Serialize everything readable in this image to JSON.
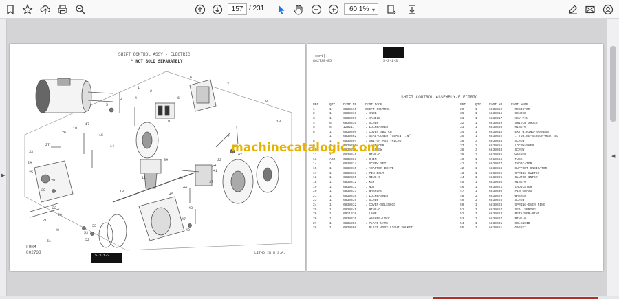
{
  "toolbar": {
    "page_current": "157",
    "page_total": "/ 231",
    "zoom": "60.1%",
    "icons": {
      "left": [
        "bookmark-icon",
        "star-icon",
        "upload-icon",
        "print-icon",
        "zoom-search-icon"
      ],
      "center": [
        "prev-page-icon",
        "next-page-icon",
        "select-cursor-icon",
        "hand-icon",
        "zoom-out-icon",
        "zoom-in-icon",
        "fit-page-icon",
        "download-icon"
      ],
      "right": [
        "annotate-icon",
        "mail-icon",
        "account-icon"
      ]
    },
    "colors": {
      "cursor_active": "#1a73e8"
    }
  },
  "left_page": {
    "header": "SHIFT CONTROL ASSY - ELECTRIC",
    "note": "* NOT SOLD SEPARATELY",
    "form_label": "FORM",
    "form_number": "802738",
    "page_ref": "5-3-1-3",
    "litho": "LITHO IN U.S.A."
  },
  "right_page": {
    "header_left_1": "(cont)",
    "header_left_2": "802738-85",
    "page_ref": "5-3-1-3",
    "table_title": "SHIFT CONTROL ASSEMBLY-ELECTRIC",
    "columns": [
      "REF",
      "QTY",
      "PART NO",
      "PART NAME",
      "REF",
      "QTY",
      "PART NO",
      "PART NAME"
    ],
    "rows_left": [
      [
        "1",
        "1",
        "6836515",
        "SHIFT CONTROL"
      ],
      [
        "2",
        "1",
        "6839310",
        ". KNOB"
      ],
      [
        "3",
        "1",
        "6839309",
        ". HANDLE"
      ],
      [
        "4",
        "6",
        "6839336",
        ". SCREW"
      ],
      [
        "5",
        "6",
        "120217",
        ". LOCKWASHER"
      ],
      [
        "6",
        "1",
        "6839306",
        ". COVER SWITCH"
      ],
      [
        "7",
        "1",
        "6839362",
        ". SEAL-COVER \"CEMENT IN\""
      ],
      [
        "8",
        "1",
        "6839304",
        ". SWITCH ASSY-MICRO"
      ],
      [
        "9",
        "1",
        "6839307",
        ". . SPACER"
      ],
      [
        "10",
        "4",
        "6839308",
        ". . SCREW"
      ],
      [
        "11",
        "1",
        "6839346",
        ". RING-O"
      ],
      [
        "13",
        "ASR",
        "6839363",
        ". SHIM"
      ],
      [
        "14",
        "1",
        "6839314",
        ". SCREW SET"
      ],
      [
        "15",
        "1",
        "6839315",
        ". ADAPTER DRIVE"
      ],
      [
        "17",
        "1",
        "6839311",
        ". PIN BOLT"
      ],
      [
        "18",
        "1",
        "6839365",
        ". RING-O"
      ],
      [
        "18",
        "1",
        "6839312",
        ". KEY"
      ],
      [
        "19",
        "1",
        "6839313",
        ". NUT"
      ],
      [
        "20",
        "1",
        "6839337",
        ". WASHING"
      ],
      [
        "21",
        "1",
        "6839338",
        ". LOCKWASHER"
      ],
      [
        "23",
        "1",
        "6839339",
        ". SCREW"
      ],
      [
        "24",
        "1",
        "6839332",
        ". COVER-SOLENOID"
      ],
      [
        "25",
        "1",
        "6839345",
        ". RING-O"
      ],
      [
        "26",
        "1",
        "6011336",
        ". LAMP"
      ],
      [
        "26",
        "1",
        "6839335",
        ". WASHER-LOCK"
      ],
      [
        "27",
        "1",
        "6835351",
        ". PLATE-NAME"
      ],
      [
        "28",
        "1",
        "6839360",
        ". PLATE ASSY-LIGHT SOCKET"
      ]
    ],
    "rows_right": [
      [
        "29",
        "1",
        "6839350",
        ". RESISTOR"
      ],
      [
        "30",
        "1",
        "6839316",
        ". SENDER"
      ],
      [
        "31",
        "1",
        "6839317",
        ". KEY-PIN"
      ],
      [
        "32",
        "1",
        "6839319",
        ". SWITCH SHOES"
      ],
      [
        "33",
        "1",
        "6839366",
        ". RING-O"
      ],
      [
        "34",
        "1",
        "6839318",
        ". EXT WIRING-HARNESS"
      ],
      [
        "35",
        "1",
        "6839352",
        ". . TUBING-SENSOR-RED, BL"
      ],
      [
        "36",
        "3",
        "6839333",
        ". SCREW"
      ],
      [
        "37",
        "3",
        "6839355",
        ". LOCKWASHER"
      ],
      [
        "38",
        "3",
        "6839334",
        ". SCREW"
      ],
      [
        "39",
        "3",
        "6839335",
        ". WASHER"
      ],
      [
        "40",
        "1",
        "6010566",
        ". FUSE"
      ],
      [
        "41",
        "1",
        "6839327",
        ". INDICATOR"
      ],
      [
        "42",
        "1",
        "6839358",
        ". SUPPORT INDICATOR"
      ],
      [
        "43",
        "1",
        "6839325",
        ". SPRING SWITCH"
      ],
      [
        "44",
        "1",
        "6839326",
        ". CLUTCH-INTER"
      ],
      [
        "45",
        "1",
        "6839356",
        ". RING-O"
      ],
      [
        "46",
        "1",
        "6839321",
        ". INDICATOR"
      ],
      [
        "47",
        "1",
        "6839330",
        ". PIN GRASS"
      ],
      [
        "48",
        "2",
        "6839329",
        ". WASHER"
      ],
      [
        "49",
        "2",
        "6839325",
        ". SCREW"
      ],
      [
        "50",
        "1",
        "6839328",
        ". SPRING-OVER RING"
      ],
      [
        "51",
        "1",
        "6839357",
        ". SEAL SPRING"
      ],
      [
        "52",
        "1",
        "6839323",
        ". RETAINER-RING"
      ],
      [
        "53",
        "1",
        "6839367",
        ". RING-O"
      ],
      [
        "54",
        "1",
        "6839331",
        ". SOLENOID"
      ],
      [
        "55",
        "1",
        "6839351",
        ". GASKET"
      ]
    ]
  },
  "watermark": "machinecatalogic.com"
}
